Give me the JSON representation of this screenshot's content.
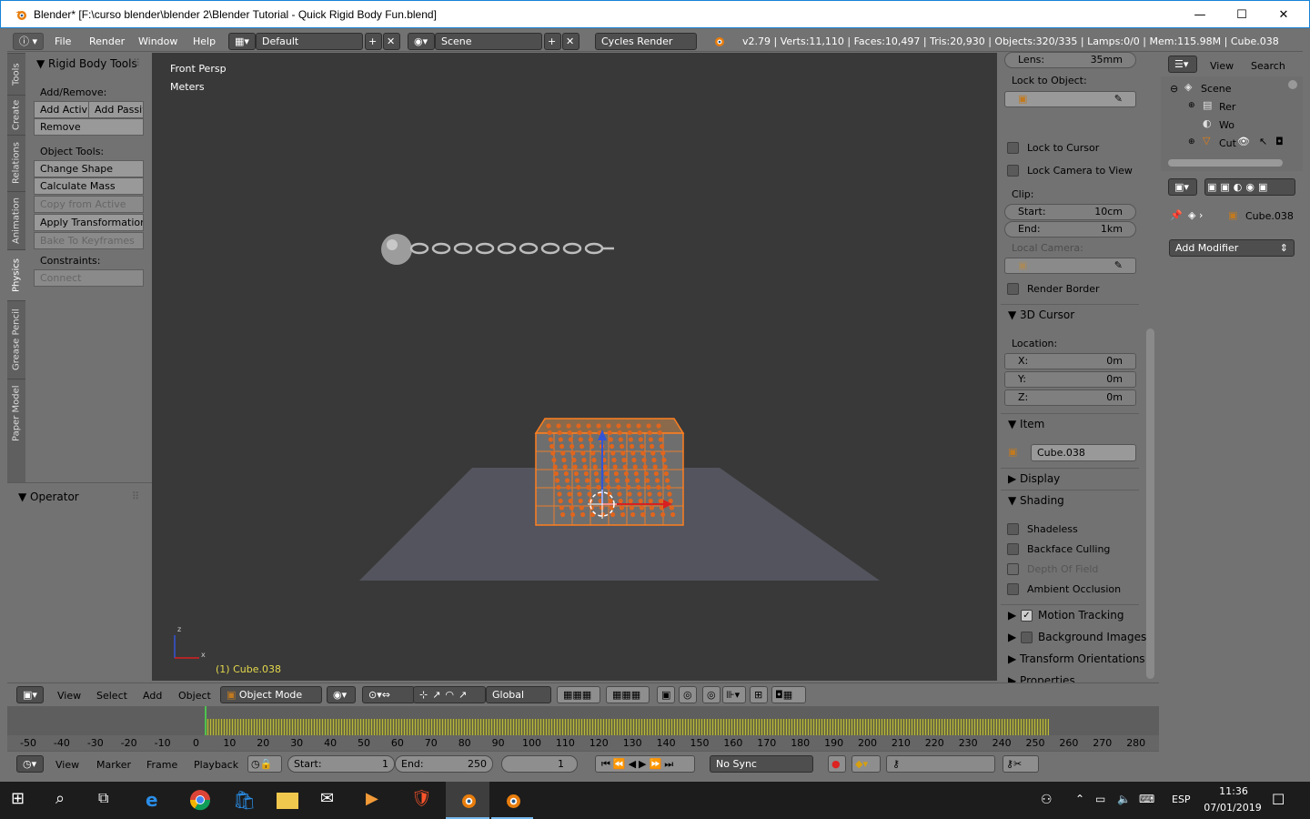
{
  "window": {
    "title": "Blender* [F:\\curso blender\\blender 2\\Blender Tutorial - Quick Rigid Body Fun.blend]",
    "minimize": "—",
    "maximize": "☐",
    "close": "✕"
  },
  "infobar": {
    "menus": [
      "File",
      "Render",
      "Window",
      "Help"
    ],
    "layout": "Default",
    "scene": "Scene",
    "engine": "Cycles Render",
    "stats": "v2.79 | Verts:11,110 | Faces:10,497 | Tris:20,930 | Objects:320/335 | Lamps:0/0 | Mem:115.98M | Cube.038"
  },
  "toolshelf": {
    "tabs": [
      "Tools",
      "Create",
      "Relations",
      "Animation",
      "Physics",
      "Grease Pencil",
      "Paper Model"
    ],
    "panel_title": "Rigid Body Tools",
    "add_remove_label": "Add/Remove:",
    "add_active": "Add Activ",
    "add_passive": "Add Passiv",
    "remove": "Remove",
    "object_tools_label": "Object Tools:",
    "change_shape": "Change Shape",
    "calculate_mass": "Calculate Mass",
    "copy_from_active": "Copy from Active",
    "apply_transformation": "Apply Transformation",
    "bake_to_keyframes": "Bake To Keyframes",
    "constraints_label": "Constraints:",
    "connect": "Connect",
    "operator_title": "Operator"
  },
  "viewport": {
    "view_name": "Front Persp",
    "units": "Meters",
    "active_object": "(1) Cube.038",
    "axis_x": "x",
    "axis_z": "z"
  },
  "npanel": {
    "lens_label": "Lens:",
    "lens_value": "35mm",
    "lock_to_object": "Lock to Object:",
    "lock_to_cursor": "Lock to Cursor",
    "lock_camera_to_view": "Lock Camera to View",
    "clip_label": "Clip:",
    "clip_start_label": "Start:",
    "clip_start": "10cm",
    "clip_end_label": "End:",
    "clip_end": "1km",
    "local_camera": "Local Camera:",
    "render_border": "Render Border",
    "cursor_section": "3D Cursor",
    "location_label": "Location:",
    "x_label": "X:",
    "x_value": "0m",
    "y_label": "Y:",
    "y_value": "0m",
    "z_label": "Z:",
    "z_value": "0m",
    "item_section": "Item",
    "item_name": "Cube.038",
    "display_section": "Display",
    "shading_section": "Shading",
    "shadeless": "Shadeless",
    "backface_culling": "Backface Culling",
    "depth_of_field": "Depth Of Field",
    "ambient_occlusion": "Ambient Occlusion",
    "motion_tracking": "Motion Tracking",
    "background_images": "Background Images",
    "transform_orientations": "Transform Orientations",
    "properties": "Properties"
  },
  "outliner": {
    "view": "View",
    "search": "Search",
    "scene": "Scene",
    "item1": "Rer",
    "item2": "Wo",
    "item3": "Cut"
  },
  "properties": {
    "object_name": "Cube.038",
    "add_modifier": "Add Modifier"
  },
  "view3d_header": {
    "view": "View",
    "select": "Select",
    "add": "Add",
    "object": "Object",
    "mode": "Object Mode",
    "orientation": "Global"
  },
  "timeline": {
    "ticks": [
      "-50",
      "-40",
      "-30",
      "-20",
      "-10",
      "0",
      "10",
      "20",
      "30",
      "40",
      "50",
      "60",
      "70",
      "80",
      "90",
      "100",
      "110",
      "120",
      "130",
      "140",
      "150",
      "160",
      "170",
      "180",
      "190",
      "200",
      "210",
      "220",
      "230",
      "240",
      "250",
      "260",
      "270",
      "280"
    ],
    "view": "View",
    "marker": "Marker",
    "frame": "Frame",
    "playback": "Playback",
    "start_label": "Start:",
    "start_value": "1",
    "end_label": "End:",
    "end_value": "250",
    "current_frame": "1",
    "sync": "No Sync"
  },
  "taskbar": {
    "lang": "ESP",
    "time": "11:36",
    "date": "07/01/2019"
  }
}
